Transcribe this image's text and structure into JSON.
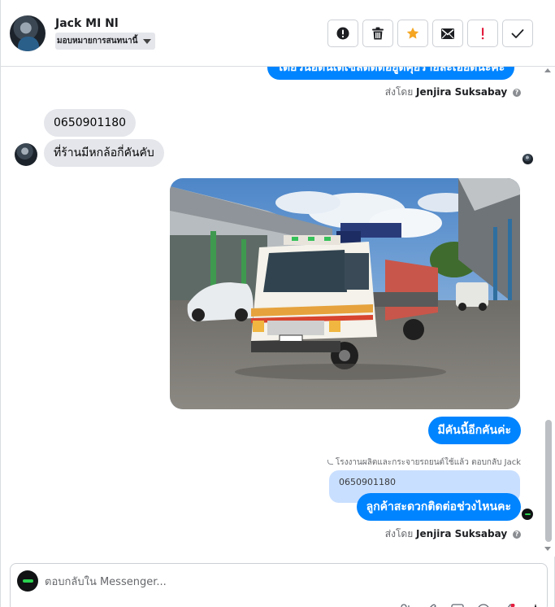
{
  "contact": {
    "name": "Jack MI Nl",
    "assignment": "มอบหมายการสนทนานี้"
  },
  "toolbar": {
    "buttons": [
      {
        "name": "spam-button",
        "icon": "alert-circle-icon"
      },
      {
        "name": "delete-button",
        "icon": "trash-icon"
      },
      {
        "name": "star-button",
        "icon": "star-icon",
        "color": "#f5a623"
      },
      {
        "name": "mark-unread-button",
        "icon": "envelope-icon"
      },
      {
        "name": "follow-up-button",
        "icon": "exclamation-icon",
        "color": "#e41e3f"
      },
      {
        "name": "mark-done-button",
        "icon": "check-icon"
      }
    ]
  },
  "messages": {
    "top_outgoing": "ไดยวนอดนเดเซลดดตอยูดคุยรายละเอยดนะคะ",
    "sent_by_prefix": "ส่งโดย",
    "agent_name": "Jenjira Suksabay",
    "incoming_phone": "0650901180",
    "incoming_question": "ที่ร้านมีหกล้อกี่คันคับ",
    "outgoing_reply": "มีคันนี้อีกคันค่ะ",
    "reply_meta": "โรงงานผลิตและกระจายรถยนต์ใช้แล้ว ตอบกลับ Jack",
    "quoted_text": "0650901180",
    "outgoing_final": "ลูกค้าสะดวกติดต่อช่วงไหนคะ"
  },
  "composer": {
    "placeholder": "ตอบกลับใน Messenger..."
  },
  "colors": {
    "accent": "#0084ff",
    "incoming_bubble": "#e4e6eb",
    "quoted_bubble": "#c9dfff"
  }
}
